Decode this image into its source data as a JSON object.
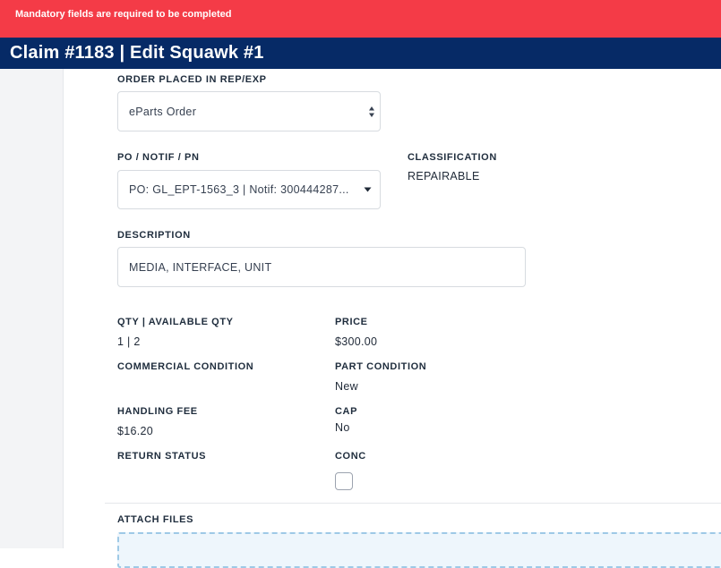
{
  "alert": {
    "message": "Mandatory fields are required to be completed"
  },
  "header": {
    "title": "Claim #1183 | Edit Squawk #1"
  },
  "form": {
    "order_placed": {
      "label": "ORDER PLACED IN REP/EXP",
      "value": "eParts Order"
    },
    "po_notif_pn": {
      "label": "PO / NOTIF / PN",
      "value": "PO: GL_EPT-1563_3 | Notif: 300444287..."
    },
    "classification": {
      "label": "CLASSIFICATION",
      "value": "REPAIRABLE"
    },
    "description": {
      "label": "DESCRIPTION",
      "value": "MEDIA, INTERFACE, UNIT"
    },
    "qty": {
      "label": "QTY | AVAILABLE QTY",
      "value": "1 | 2"
    },
    "price": {
      "label": "PRICE",
      "value": "$300.00"
    },
    "commercial_condition": {
      "label": "COMMERCIAL CONDITION",
      "value": ""
    },
    "part_condition": {
      "label": "PART CONDITION",
      "value": "New"
    },
    "handling_fee": {
      "label": "HANDLING FEE",
      "value": "$16.20"
    },
    "cap": {
      "label": "CAP",
      "value": "No"
    },
    "return_status": {
      "label": "RETURN STATUS",
      "value": ""
    },
    "conc": {
      "label": "CONC",
      "checked": false
    },
    "attach_files": {
      "label": "ATTACH FILES"
    }
  },
  "icons": {
    "order_select": "sort-arrows-icon",
    "po_select": "caret-down-icon"
  },
  "colors": {
    "alert_bg": "#f43b47",
    "header_bg": "#062a66",
    "dropzone_border": "#9ec9e6"
  }
}
